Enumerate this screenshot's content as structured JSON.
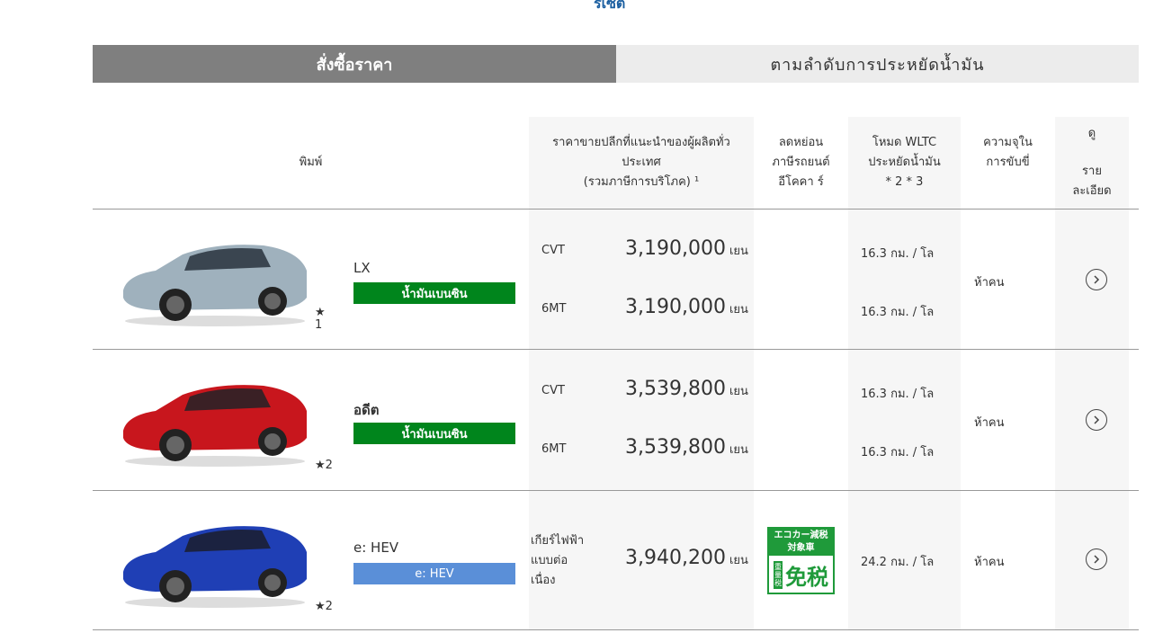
{
  "top_link": "รีเซ็ต",
  "tabs": {
    "active": "สั่งซื้อราคา",
    "inactive": "ตามลำดับการประหยัดน้ำมัน"
  },
  "header": {
    "type": "พิมพ์",
    "price_line1": "ราคาขายปลีกที่แนะนำของผู้ผลิตทั่ว",
    "price_line2": "ประเทศ",
    "price_line3": "(รวมภาษีการบริโภค) ¹",
    "eco_line1": "ลดหย่อน",
    "eco_line2": "ภาษีรถยนต์",
    "eco_line3": "อีโคคา ร์",
    "wltc_line1": "โหมด WLTC",
    "wltc_line2": "ประหยัดน้ำมัน",
    "wltc_line3": "* 2 * 3",
    "cap_line1": "ความจุใน",
    "cap_line2": "การขับขี่",
    "detail_line1": "ดู",
    "detail_line2": "ราย",
    "detail_line3": "ละเอียด"
  },
  "rows": [
    {
      "name": "LX",
      "badge": "น้ำมันเบนซิน",
      "star_mark": "★",
      "star_note": "1",
      "car_color": "#9fb1bd",
      "variants": [
        {
          "trans": "CVT",
          "price": "3,190,000",
          "unit": "เยน",
          "fuel": "16.3 กม. / โล"
        },
        {
          "trans": "6MT",
          "price": "3,190,000",
          "unit": "เยน",
          "fuel": "16.3 กม. / โล"
        }
      ],
      "capacity": "ห้าคน"
    },
    {
      "name": "อดีต",
      "badge": "น้ำมันเบนซิน",
      "star": "★2",
      "car_color": "#c8161d",
      "variants": [
        {
          "trans": "CVT",
          "price": "3,539,800",
          "unit": "เยน",
          "fuel": "16.3 กม. / โล"
        },
        {
          "trans": "6MT",
          "price": "3,539,800",
          "unit": "เยน",
          "fuel": "16.3 กม. / โล"
        }
      ],
      "capacity": "ห้าคน"
    },
    {
      "name": "e: HEV",
      "badge": "e: HEV",
      "star": "★2",
      "car_color": "#1f3fb5",
      "trans_1": "เกียร์ไฟฟ้า",
      "trans_2": "แบบต่อ",
      "trans_3": "เนื่อง",
      "price": "3,940,200",
      "unit": "เยน",
      "fuel": "24.2 กม. / โล",
      "eco_label": {
        "top1": "エコカー減税",
        "top2": "対象車",
        "side": "重量税",
        "main": "免税"
      },
      "capacity": "ห้าคน"
    }
  ]
}
